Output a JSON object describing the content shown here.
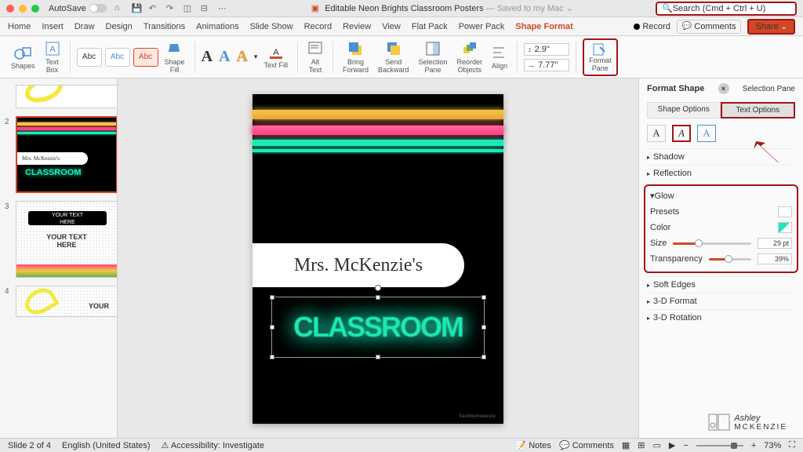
{
  "titlebar": {
    "autosave": "AutoSave",
    "doc_title": "Editable Neon Brights Classroom Posters",
    "saved": "— Saved to my Mac",
    "search_ph": "Search (Cmd + Ctrl + U)"
  },
  "tabs": {
    "home": "Home",
    "insert": "Insert",
    "draw": "Draw",
    "design": "Design",
    "transitions": "Transitions",
    "animations": "Animations",
    "slideshow": "Slide Show",
    "record": "Record",
    "review": "Review",
    "view": "View",
    "flatpack": "Flat Pack",
    "powerpack": "Power Pack",
    "shapeformat": "Shape Format",
    "rec_btn": "Record",
    "comments": "Comments",
    "share": "Share"
  },
  "ribbon": {
    "shapes": "Shapes",
    "textbox": "Text\nBox",
    "abc": "Abc",
    "shapefill": "Shape\nFill",
    "textfill": "Text Fill",
    "alttext": "Alt\nText",
    "bringfwd": "Bring\nForward",
    "sendback": "Send\nBackward",
    "selpane": "Selection\nPane",
    "reorder": "Reorder\nObjects",
    "align": "Align",
    "height": "2.9\"",
    "width": "7.77\"",
    "formatpane": "Format\nPane"
  },
  "slide": {
    "teacher": "Mrs. McKenzie's",
    "classroom": "CLASSROOM",
    "credit": "©ashleymckenzie"
  },
  "thumbs": {
    "n2": "2",
    "n3": "3",
    "n4": "4",
    "yt": "YOUR TEXT\nHERE",
    "yt2": "YOUR TEXT HERE",
    "your": "YOUR"
  },
  "panel": {
    "title": "Format Shape",
    "selpane": "Selection Pane",
    "shapeopt": "Shape Options",
    "textopt": "Text Options",
    "shadow": "Shadow",
    "reflection": "Reflection",
    "glow": "Glow",
    "softedges": "Soft Edges",
    "fmt3d": "3-D Format",
    "rot3d": "3-D Rotation",
    "presets": "Presets",
    "color": "Color",
    "size": "Size",
    "transparency": "Transparency",
    "size_val": "29 pt",
    "trans_val": "39%"
  },
  "status": {
    "slide": "Slide 2 of 4",
    "lang": "English (United States)",
    "access": "Accessibility: Investigate",
    "notes": "Notes",
    "comments": "Comments",
    "zoom": "73%"
  },
  "watermark": {
    "name1": "Ashley",
    "name2": "MCKENZIE"
  }
}
